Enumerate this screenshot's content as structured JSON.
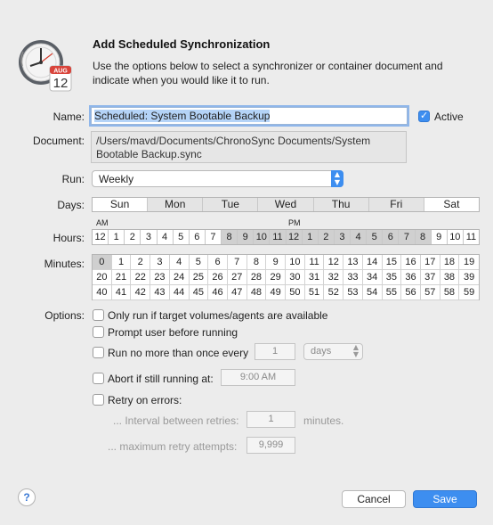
{
  "header": {
    "title": "Add Scheduled Synchronization",
    "description": "Use the options below to select a synchronizer or container document and indicate when you would like it to run.",
    "icon": "chronosync-clock-calendar-icon",
    "calendar_month": "AUG",
    "calendar_day": "12"
  },
  "form": {
    "name_label": "Name:",
    "name_value": "Scheduled: System Bootable Backup",
    "active_label": "Active",
    "active_checked": true,
    "document_label": "Document:",
    "document_path": "/Users/mavd/Documents/ChronoSync Documents/System Bootable Backup.sync",
    "run_label": "Run:",
    "run_value": "Weekly",
    "days_label": "Days:",
    "hours_label": "Hours:",
    "minutes_label": "Minutes:",
    "options_label": "Options:"
  },
  "days": [
    {
      "label": "Sun",
      "selected": true
    },
    {
      "label": "Mon",
      "selected": false
    },
    {
      "label": "Tue",
      "selected": false
    },
    {
      "label": "Wed",
      "selected": false
    },
    {
      "label": "Thu",
      "selected": false
    },
    {
      "label": "Fri",
      "selected": false
    },
    {
      "label": "Sat",
      "selected": true
    }
  ],
  "am_label": "AM",
  "pm_label": "PM",
  "hours": [
    {
      "label": "12",
      "selected": true
    },
    {
      "label": "1",
      "selected": true
    },
    {
      "label": "2",
      "selected": true
    },
    {
      "label": "3",
      "selected": true
    },
    {
      "label": "4",
      "selected": true
    },
    {
      "label": "5",
      "selected": true
    },
    {
      "label": "6",
      "selected": true
    },
    {
      "label": "7",
      "selected": true
    },
    {
      "label": "8",
      "selected": false
    },
    {
      "label": "9",
      "selected": false
    },
    {
      "label": "10",
      "selected": false
    },
    {
      "label": "11",
      "selected": false
    },
    {
      "label": "12",
      "selected": false
    },
    {
      "label": "1",
      "selected": false
    },
    {
      "label": "2",
      "selected": false
    },
    {
      "label": "3",
      "selected": false
    },
    {
      "label": "4",
      "selected": false
    },
    {
      "label": "5",
      "selected": false
    },
    {
      "label": "6",
      "selected": false
    },
    {
      "label": "7",
      "selected": false
    },
    {
      "label": "8",
      "selected": false
    },
    {
      "label": "9",
      "selected": true
    },
    {
      "label": "10",
      "selected": true
    },
    {
      "label": "11",
      "selected": true
    }
  ],
  "minutes": {
    "selected": [
      "0"
    ],
    "values": [
      "0",
      "1",
      "2",
      "3",
      "4",
      "5",
      "6",
      "7",
      "8",
      "9",
      "10",
      "11",
      "12",
      "13",
      "14",
      "15",
      "16",
      "17",
      "18",
      "19",
      "20",
      "21",
      "22",
      "23",
      "24",
      "25",
      "26",
      "27",
      "28",
      "29",
      "30",
      "31",
      "32",
      "33",
      "34",
      "35",
      "36",
      "37",
      "38",
      "39",
      "40",
      "41",
      "42",
      "43",
      "44",
      "45",
      "46",
      "47",
      "48",
      "49",
      "50",
      "51",
      "52",
      "53",
      "54",
      "55",
      "56",
      "57",
      "58",
      "59"
    ]
  },
  "options": {
    "only_run_label": "Only run if target volumes/agents are available",
    "prompt_user_label": "Prompt user before running",
    "run_no_more_label": "Run no more than once every",
    "run_no_more_value": "1",
    "run_no_more_unit": "days",
    "abort_label": "Abort if still running at:",
    "abort_time": "9:00 AM",
    "retry_label": "Retry on errors:",
    "interval_label": "... Interval between retries:",
    "interval_value": "1",
    "interval_unit": "minutes.",
    "max_retry_label": "... maximum retry attempts:",
    "max_retry_value": "9,999"
  },
  "buttons": {
    "help": "?",
    "cancel": "Cancel",
    "save": "Save"
  },
  "colors": {
    "accent": "#3d8ef0",
    "background": "#ececec"
  }
}
